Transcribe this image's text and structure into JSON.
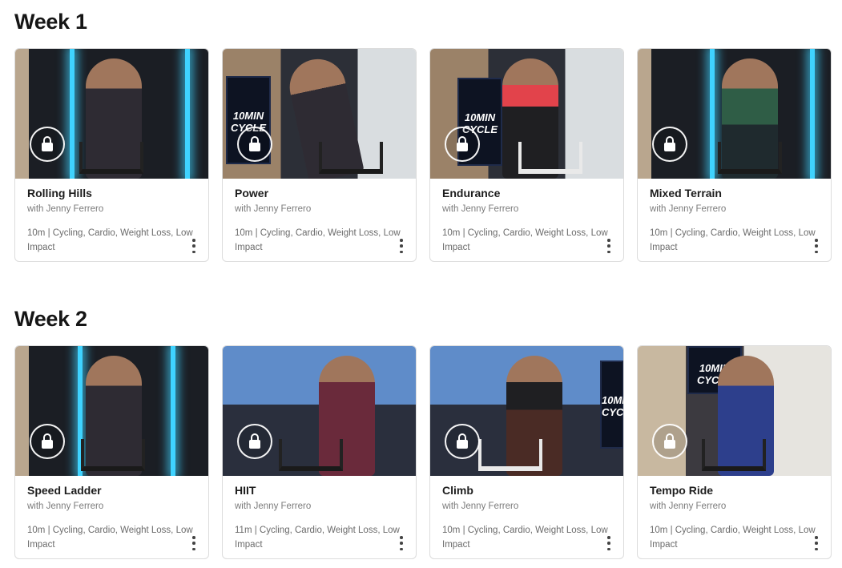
{
  "weeks": [
    {
      "title": "Week 1",
      "cards": [
        {
          "title": "Rolling Hills",
          "instructor": "with Jenny Ferrero",
          "meta": "10m | Cycling, Cardio, Weight Loss, Low Impact"
        },
        {
          "title": "Power",
          "instructor": "with Jenny Ferrero",
          "meta": "10m | Cycling, Cardio, Weight Loss, Low Impact"
        },
        {
          "title": "Endurance",
          "instructor": "with Jenny Ferrero",
          "meta": "10m | Cycling, Cardio, Weight Loss, Low Impact"
        },
        {
          "title": "Mixed Terrain",
          "instructor": "with Jenny Ferrero",
          "meta": "10m | Cycling, Cardio, Weight Loss, Low Impact"
        }
      ]
    },
    {
      "title": "Week 2",
      "cards": [
        {
          "title": "Speed Ladder",
          "instructor": "with Jenny Ferrero",
          "meta": "10m | Cycling, Cardio, Weight Loss, Low Impact"
        },
        {
          "title": "HIIT",
          "instructor": "with Jenny Ferrero",
          "meta": "11m | Cycling, Cardio, Weight Loss, Low Impact"
        },
        {
          "title": "Climb",
          "instructor": "with Jenny Ferrero",
          "meta": "10m | Cycling, Cardio, Weight Loss, Low Impact"
        },
        {
          "title": "Tempo Ride",
          "instructor": "with Jenny Ferrero",
          "meta": "10m | Cycling, Cardio, Weight Loss, Low Impact"
        }
      ]
    }
  ],
  "thumbnail_logo_text": "10MIN CYCLE",
  "icons": {
    "lock": "lock-icon",
    "more": "more-vertical-icon"
  }
}
